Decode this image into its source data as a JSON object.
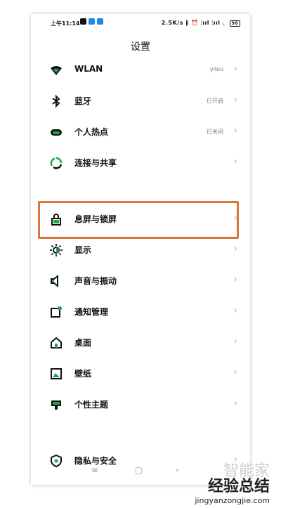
{
  "status": {
    "time": "上午11:14",
    "app_icons": [
      "#111111",
      "#1e88e5",
      "#1e88e5"
    ],
    "right": "2.5K/s ∦ ⏰ ⫶ııl ⫶ııl ◟",
    "battery": "98"
  },
  "header": {
    "title": "设置"
  },
  "items": [
    {
      "icon": "wifi-icon",
      "label": "WLAN",
      "value": "yilou"
    },
    {
      "icon": "bluetooth-icon",
      "label": "蓝牙",
      "value": "已开启"
    },
    {
      "icon": "hotspot-icon",
      "label": "个人热点",
      "value": "已关闭"
    },
    {
      "icon": "connect-share-icon",
      "label": "连接与共享",
      "value": ""
    },
    {
      "icon": "lock-icon",
      "label": "息屏与锁屏",
      "value": ""
    },
    {
      "icon": "brightness-icon",
      "label": "显示",
      "value": ""
    },
    {
      "icon": "speaker-icon",
      "label": "声音与振动",
      "value": ""
    },
    {
      "icon": "notification-icon",
      "label": "通知管理",
      "value": ""
    },
    {
      "icon": "home-icon",
      "label": "桌面",
      "value": ""
    },
    {
      "icon": "wallpaper-icon",
      "label": "壁纸",
      "value": ""
    },
    {
      "icon": "theme-icon",
      "label": "个性主题",
      "value": ""
    },
    {
      "icon": "privacy-icon",
      "label": "隐私与安全",
      "value": ""
    }
  ],
  "accent": "#1aa84a",
  "highlight_color": "#d9763c",
  "nav": {
    "menu": "≡",
    "home": "▢",
    "back": "‹"
  },
  "watermark": {
    "ghost": "智能家",
    "line1": "经验总结",
    "line2": "jingyanzongjie.com"
  }
}
